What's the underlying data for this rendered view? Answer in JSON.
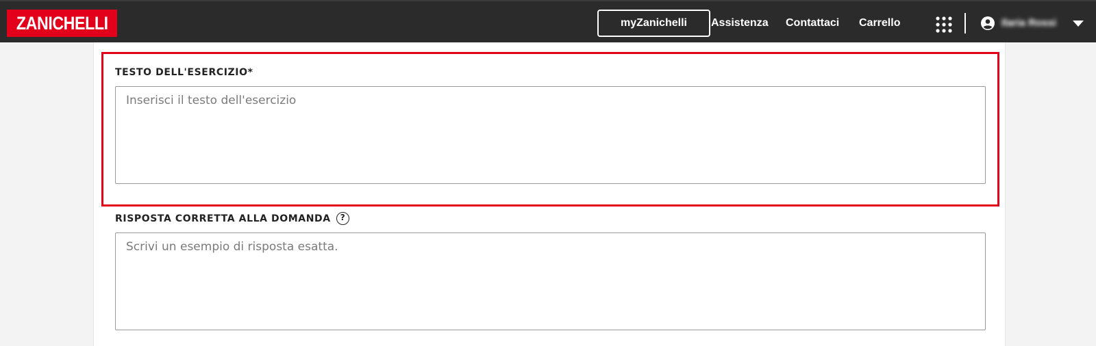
{
  "header": {
    "logo_text": "ZANICHELLI",
    "my_button_label": "myZanichelli",
    "nav_links": [
      "Assistenza",
      "Contattaci",
      "Carrello"
    ],
    "user_name": "Ilaria Rossi",
    "colors": {
      "bar": "#2b2b2b",
      "brand": "#e2001a"
    },
    "icons": [
      "apps-grid-icon",
      "user-account-icon",
      "caret-down-icon"
    ]
  },
  "form": {
    "exercise_text": {
      "label": "TESTO DELL'ESERCIZIO*",
      "placeholder": "Inserisci il testo dell'esercizio",
      "value": ""
    },
    "correct_answer": {
      "label": "RISPOSTA CORRETTA ALLA DOMANDA",
      "help_icon": "?",
      "placeholder": "Scrivi un esempio di risposta esatta.",
      "value": ""
    }
  }
}
